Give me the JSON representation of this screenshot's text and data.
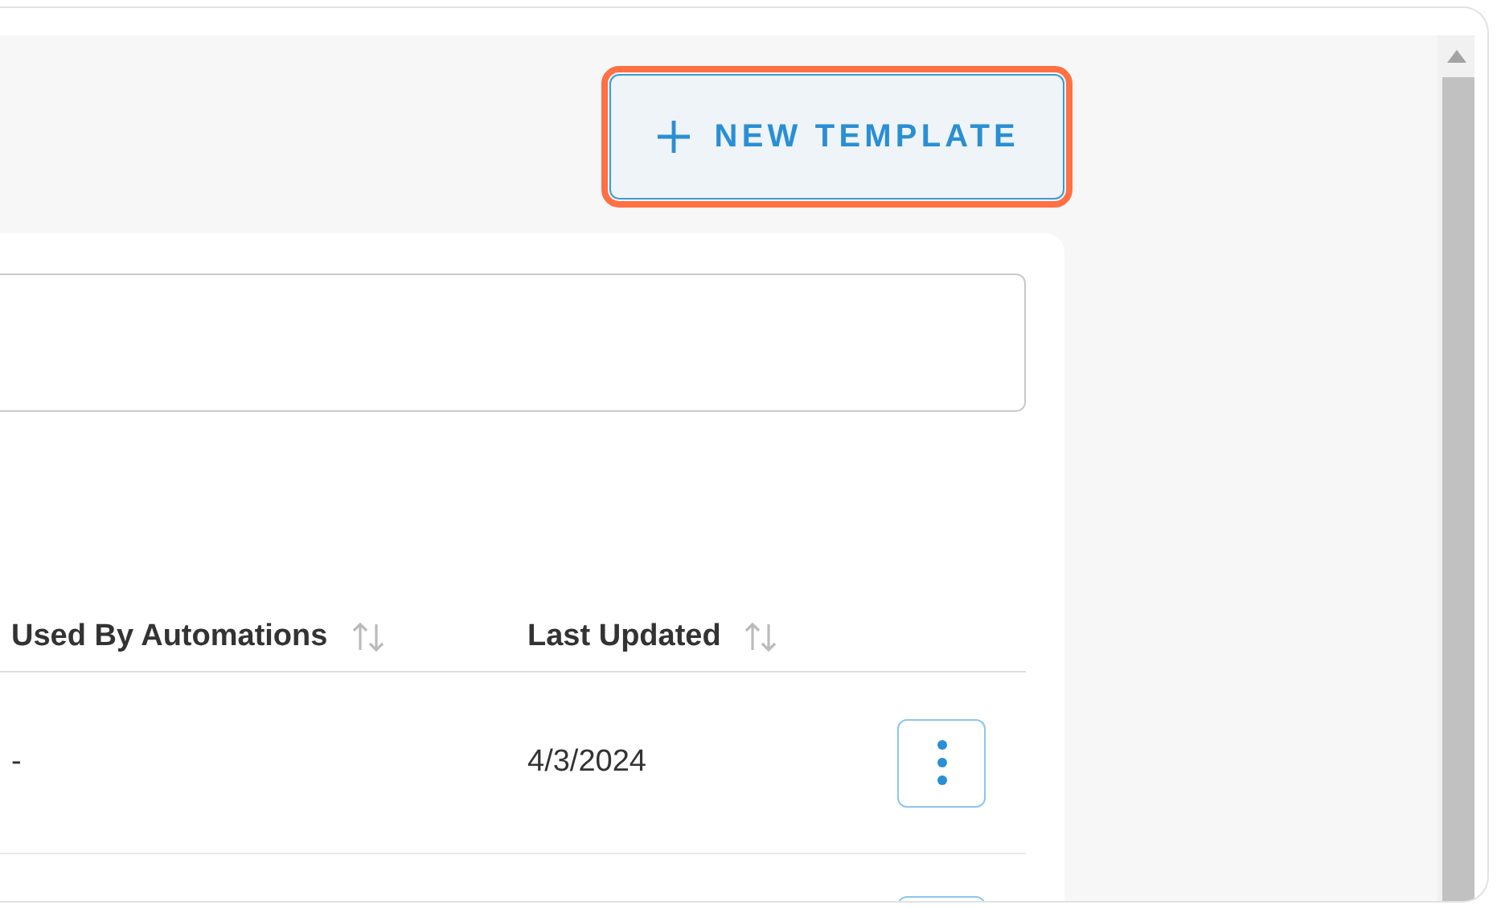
{
  "new_template_button": {
    "label": "NEW TEMPLATE",
    "focused": true
  },
  "table": {
    "columns": [
      {
        "label": "Used By Automations",
        "sortable": true
      },
      {
        "label": "Last Updated",
        "sortable": true
      }
    ],
    "rows": [
      {
        "kind": "full",
        "used_by_automations": "-",
        "last_updated": "4/3/2024"
      },
      {
        "kind": "partial"
      }
    ]
  }
}
